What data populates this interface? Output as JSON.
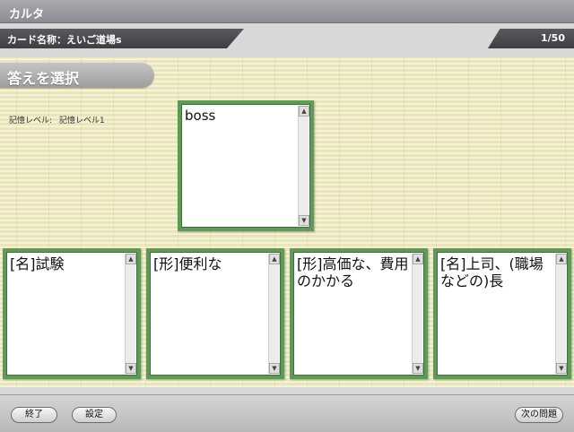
{
  "window": {
    "title": "カルタ"
  },
  "infobar": {
    "card_name": "カード名称：えいご道場s",
    "counter": "1/50"
  },
  "section": {
    "title": "答えを選択"
  },
  "memory": {
    "label": "記憶レベル:",
    "value": "記憶レベル1"
  },
  "question": {
    "text": "boss"
  },
  "answers": [
    {
      "text": "[名]試験"
    },
    {
      "text": "[形]便利な"
    },
    {
      "text": "[形]高価な、費用のかかる"
    },
    {
      "text": "[名]上司、(職場などの)長"
    }
  ],
  "footer": {
    "exit_label": "終了",
    "settings_label": "設定",
    "next_label": "次の問題"
  },
  "icons": {
    "scroll_up": "scroll-up-arrow-icon",
    "scroll_down": "scroll-down-arrow-icon"
  },
  "colors": {
    "card_border": "#5e9b54",
    "background": "#e9e6bd"
  }
}
